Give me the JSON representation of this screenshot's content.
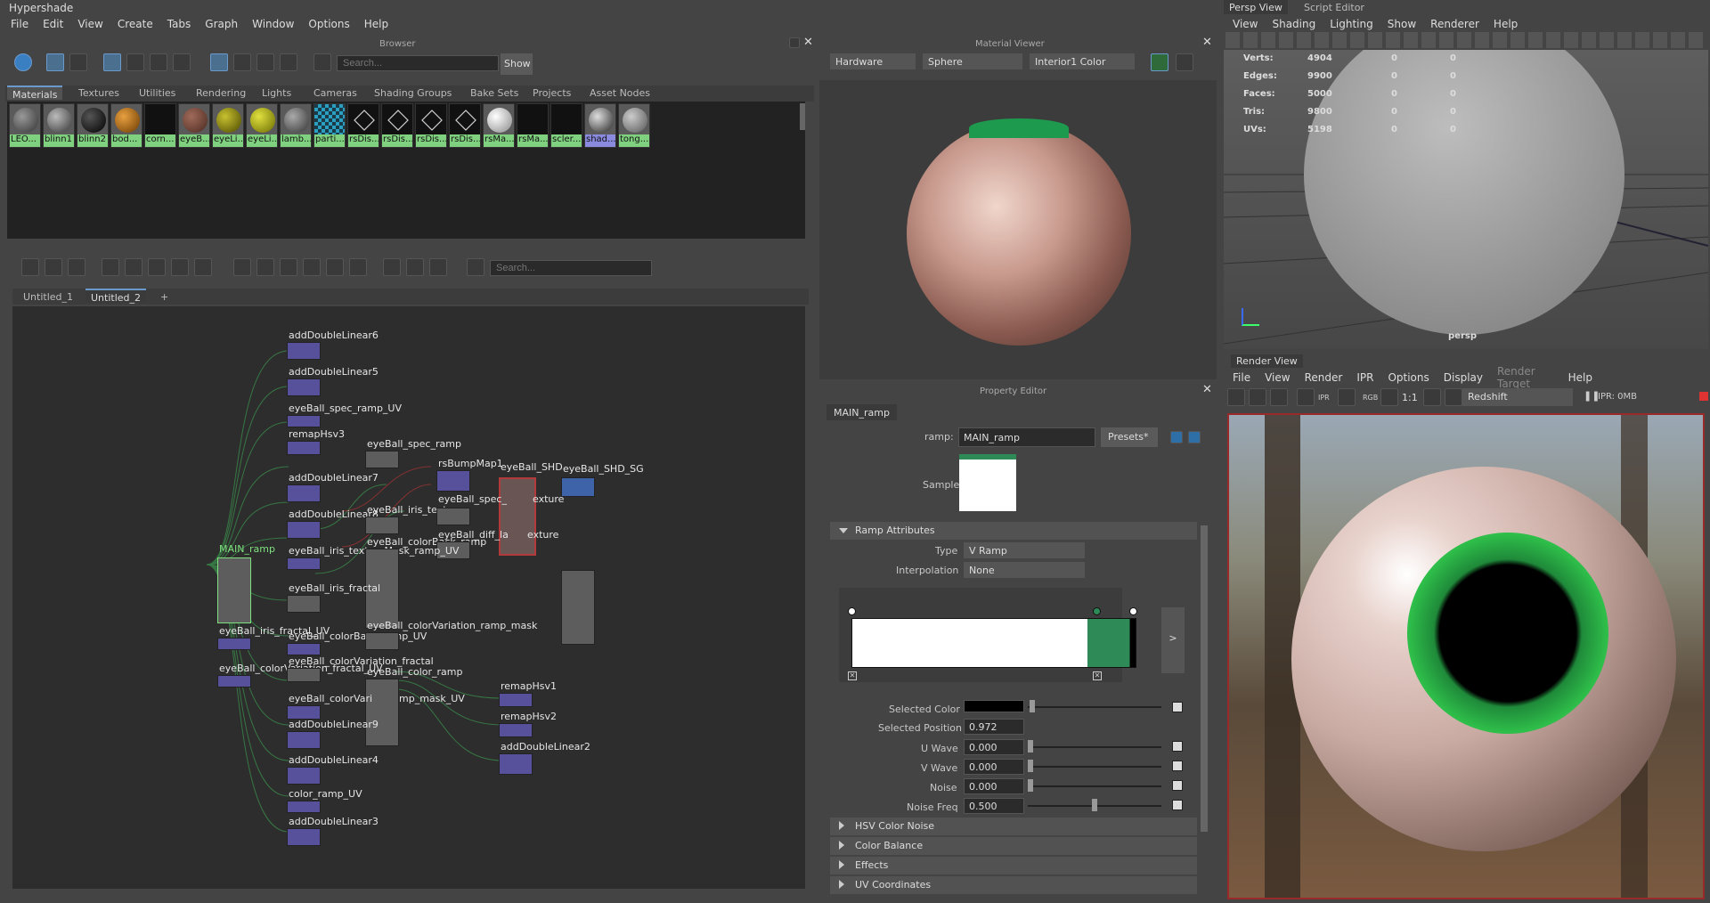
{
  "window_title": "Hypershade",
  "menu": [
    "File",
    "Edit",
    "View",
    "Create",
    "Tabs",
    "Graph",
    "Window",
    "Options",
    "Help"
  ],
  "browser": {
    "title": "Browser",
    "search_placeholder": "Search...",
    "show_button": "Show",
    "tabs": [
      "Materials",
      "Textures",
      "Utilities",
      "Rendering",
      "Lights",
      "Cameras",
      "Shading Groups",
      "Bake Sets",
      "Projects",
      "Asset Nodes"
    ],
    "swatches": [
      "LEO...",
      "blinn1",
      "blinn2",
      "bod...",
      "corn...",
      "eyeB...",
      "eyeLi...",
      "eyeLi...",
      "lamb...",
      "parti...",
      "rsDis...",
      "rsDis...",
      "rsDis...",
      "rsDis...",
      "rsMa...",
      "rsMa...",
      "scler...",
      "shad...",
      "tong..."
    ]
  },
  "graph": {
    "search_placeholder": "Search...",
    "tabs": [
      "Untitled_1",
      "Untitled_2",
      "+"
    ],
    "nodes": [
      "addDoubleLinear6",
      "addDoubleLinear5",
      "eyeBall_spec_ramp_UV",
      "remapHsv3",
      "eyeBall_spec_ramp",
      "addDoubleLinear7",
      "addDoubleLinear8",
      "eyeBall_iris_texture",
      "rsBumpMap1",
      "eyeBall_SHD",
      "eyeBall_SHD_SG",
      "eyeBall_spec_",
      "exture",
      "eyeBall_colorBack_ramp",
      "eyeBall_diff_la",
      "MAIN_ramp",
      "eyeBall_iris_textureMask_ramp_UV",
      "eyeBall_iris_fractal",
      "eyeBall_iris_fractal_UV",
      "eyeBall_colorBack_ramp_UV",
      "eyeBall_colorVariation_ramp_mask",
      "eyeBall_colorVariation_fractal_UV",
      "eyeBall_colorVariation_fractal",
      "eyeBall_color_ramp",
      "eyeBall_colorVari",
      "mp_mask_UV",
      "remapHsv1",
      "remapHsv2",
      "addDoubleLinear9",
      "addDoubleLinear4",
      "addDoubleLinear2",
      "color_ramp_UV",
      "addDoubleLinear3"
    ]
  },
  "material_viewer": {
    "title": "Material Viewer",
    "renderer": "Hardware",
    "shape": "Sphere",
    "environment": "Interior1 Color"
  },
  "property_editor": {
    "title": "Property Editor",
    "node_tab": "MAIN_ramp",
    "ramp_label": "ramp:",
    "ramp_value": "MAIN_ramp",
    "presets_button": "Presets*",
    "sample_label": "Sample",
    "section_ramp": "Ramp Attributes",
    "type_label": "Type",
    "type_value": "V Ramp",
    "interp_label": "Interpolation",
    "interp_value": "None",
    "expand_button": ">",
    "selected_color_label": "Selected Color",
    "selected_position_label": "Selected Position",
    "selected_position": "0.972",
    "u_wave_label": "U Wave",
    "u_wave": "0.000",
    "v_wave_label": "V Wave",
    "v_wave": "0.000",
    "noise_label": "Noise",
    "noise": "0.000",
    "noise_freq_label": "Noise Freq",
    "noise_freq": "0.500",
    "sections_collapsed": [
      "HSV Color Noise",
      "Color Balance",
      "Effects",
      "UV Coordinates"
    ]
  },
  "persp_view": {
    "tabs": [
      "Persp View",
      "Script Editor"
    ],
    "menu": [
      "View",
      "Shading",
      "Lighting",
      "Show",
      "Renderer",
      "Help"
    ],
    "stats": [
      {
        "label": "Verts:",
        "v": "4904",
        "a": "0",
        "b": "0"
      },
      {
        "label": "Edges:",
        "v": "9900",
        "a": "0",
        "b": "0"
      },
      {
        "label": "Faces:",
        "v": "5000",
        "a": "0",
        "b": "0"
      },
      {
        "label": "Tris:",
        "v": "9800",
        "a": "0",
        "b": "0"
      },
      {
        "label": "UVs:",
        "v": "5198",
        "a": "0",
        "b": "0"
      }
    ],
    "camera_label": "persp"
  },
  "render_view": {
    "title": "Render View",
    "menu": [
      "File",
      "View",
      "Render",
      "IPR",
      "Options",
      "Display",
      "Render Target",
      "Help"
    ],
    "ratio": "1:1",
    "renderer": "Redshift",
    "ipr_mem": "IPR: 0MB",
    "rgb_label": "RGB",
    "ipr_icon_label": "IPR"
  },
  "colors": {
    "accent": "#6a9acb",
    "ramp_green": "#2e8b57",
    "swatch_label": "#7fd07f",
    "node_purple": "#57509a"
  }
}
